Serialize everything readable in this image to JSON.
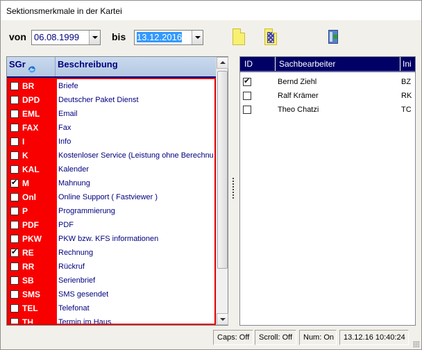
{
  "window": {
    "title": "Sektionsmerkmale in der Kartei"
  },
  "filter": {
    "from_label": "von",
    "from_date": "06.08.1999",
    "to_label": "bis",
    "to_date": "13.12.2016"
  },
  "toolbar": {
    "icons": [
      "document-icon",
      "select-all-document-icon",
      "exit-door-icon"
    ]
  },
  "left_table": {
    "columns": [
      "SGr",
      "Beschreibung"
    ],
    "rows": [
      {
        "code": "BR",
        "description": "Briefe",
        "checked": false
      },
      {
        "code": "DPD",
        "description": "Deutscher Paket Dienst",
        "checked": false
      },
      {
        "code": "EML",
        "description": "Email",
        "checked": false
      },
      {
        "code": "FAX",
        "description": "Fax",
        "checked": false
      },
      {
        "code": "I",
        "description": "Info",
        "checked": false
      },
      {
        "code": "K",
        "description": "Kostenloser Service (Leistung ohne Berechnu...",
        "checked": false
      },
      {
        "code": "KAL",
        "description": "Kalender",
        "checked": false
      },
      {
        "code": "M",
        "description": "Mahnung",
        "checked": true
      },
      {
        "code": "Onl",
        "description": "Online Support ( Fastviewer )",
        "checked": false
      },
      {
        "code": "P",
        "description": "Programmierung",
        "checked": false
      },
      {
        "code": "PDF",
        "description": "PDF",
        "checked": false
      },
      {
        "code": "PKW",
        "description": "PKW bzw. KFS informationen",
        "checked": false
      },
      {
        "code": "RE",
        "description": "Rechnung",
        "checked": true
      },
      {
        "code": "RR",
        "description": "Rückruf",
        "checked": false
      },
      {
        "code": "SB",
        "description": "Serienbrief",
        "checked": false
      },
      {
        "code": "SMS",
        "description": "SMS gesendet",
        "checked": false
      },
      {
        "code": "TEL",
        "description": "Telefonat",
        "checked": false
      },
      {
        "code": "TH",
        "description": "Termin im Haus",
        "checked": false
      }
    ]
  },
  "right_table": {
    "columns": [
      "ID",
      "Sachbearbeiter",
      "Ini"
    ],
    "rows": [
      {
        "name": "Bernd Ziehl",
        "ini": "BZ",
        "checked": true
      },
      {
        "name": "Ralf Krämer",
        "ini": "RK",
        "checked": false
      },
      {
        "name": "Theo Chatzi",
        "ini": "TC",
        "checked": false
      }
    ]
  },
  "status": {
    "caps": "Caps: Off",
    "scroll": "Scroll: Off",
    "num": "Num: On",
    "datetime": "13.12.16 10:40:24"
  },
  "colors": {
    "code_bg": "#f80000",
    "header_right_bg": "#000066",
    "description_text": "#00007f"
  }
}
